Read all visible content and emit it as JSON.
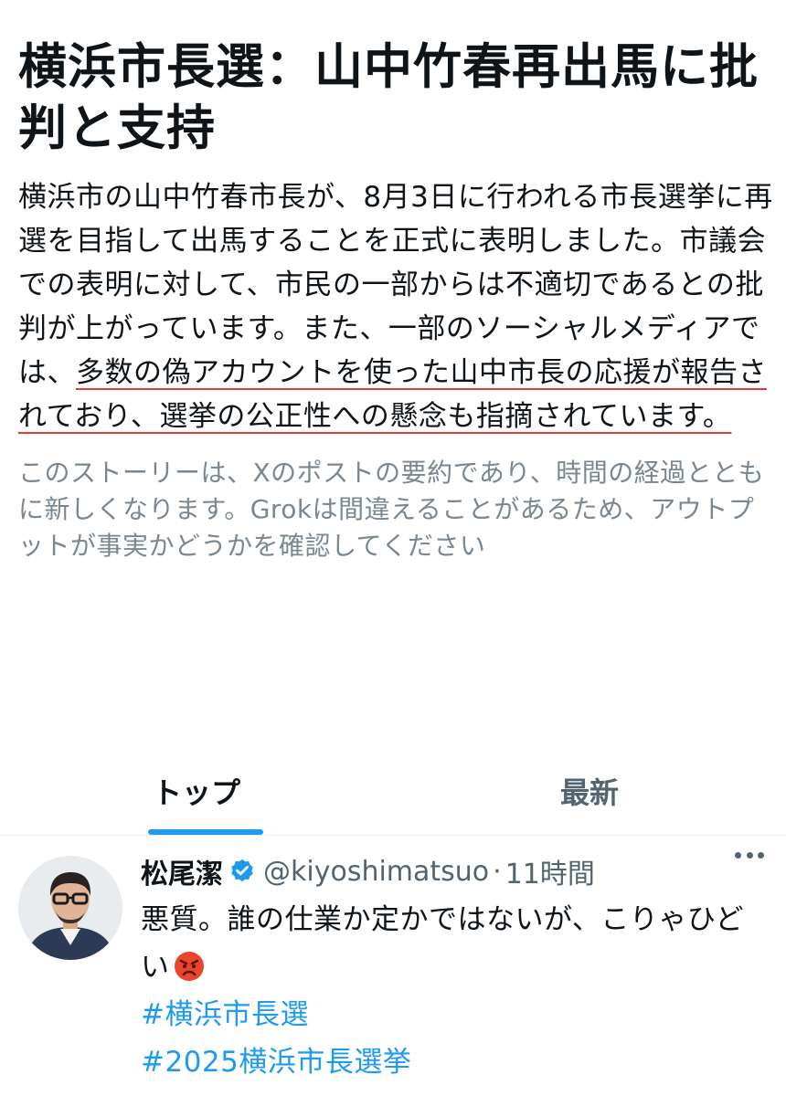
{
  "story": {
    "title": "横浜市長選：山中竹春再出馬に批判と支持",
    "summary_before": "横浜市の山中竹春市長が、8月3日に行われる市長選挙に再選を目指して出馬することを正式に表明しました。市議会での表明に対して、市民の一部からは不適切であるとの批判が上がっています。また、一部のソーシャルメディアでは、",
    "summary_marked": "多数の偽アカウントを使った山中市長の応援が報告されており、選挙の公正性への懸念も指摘されています。",
    "summary_after": "",
    "disclaimer": "このストーリーは、Xのポストの要約であり、時間の経過とともに新しくなります。Grokは間違えることがあるため、アウトプットが事実かどうかを確認してください"
  },
  "colors": {
    "accent": "#1d9bf0",
    "annotation_red": "#e53935",
    "muted_text": "#536471",
    "angry_emoji": "#e8452b"
  },
  "tabs": [
    {
      "label": "トップ",
      "active": true
    },
    {
      "label": "最新",
      "active": false
    }
  ],
  "post": {
    "author_name": "松尾潔",
    "verified": true,
    "handle": "@kiyoshimatsuo",
    "separator": "·",
    "time": "11時間",
    "text": "悪質。誰の仕業か定かではないが、こりゃひどい",
    "emoji_icon": "angry-face-icon",
    "hashtags": [
      "#横浜市長選",
      "#2025横浜市長選挙"
    ],
    "more_icon": "more-options-icon"
  }
}
